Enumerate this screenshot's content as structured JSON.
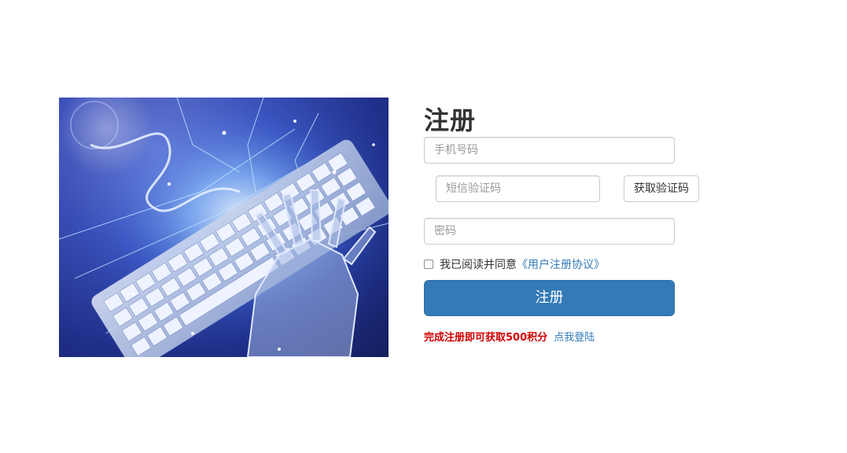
{
  "form": {
    "title": "注册",
    "phone_placeholder": "手机号码",
    "sms_placeholder": "短信验证码",
    "get_code_label": "获取验证码",
    "password_placeholder": "密码",
    "agree_text": "我已阅读并同意",
    "agreement_link": "《用户注册协议》",
    "submit_label": "注册",
    "promo_text": "完成注册即可获取500积分",
    "login_link": "点我登陆"
  },
  "colors": {
    "primary": "#337ab7",
    "promo": "#cc0000",
    "title": "#333333"
  },
  "icons": {
    "hero": "robot-hand-keyboard-illustration"
  }
}
